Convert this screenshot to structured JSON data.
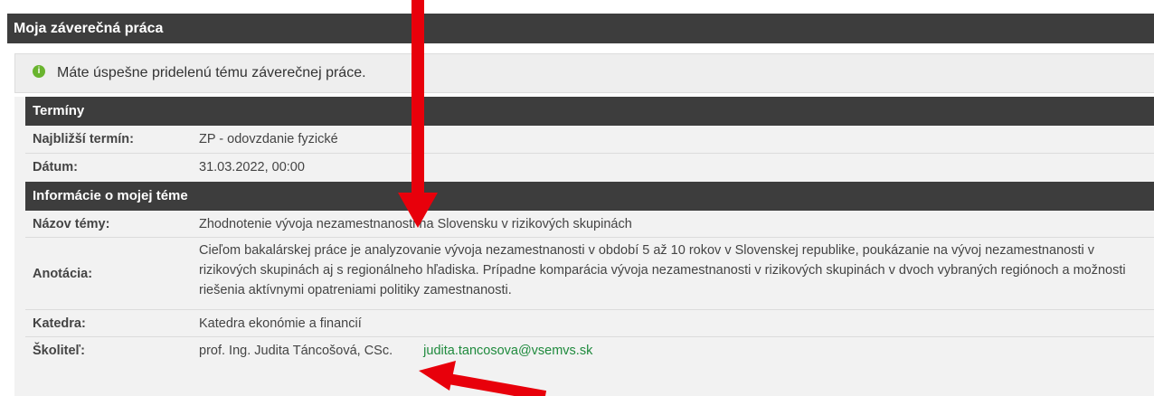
{
  "panel": {
    "title": "Moja záverečná práca"
  },
  "notice": {
    "icon": "info-icon",
    "text": "Máte úspešne pridelenú tému záverečnej práce."
  },
  "terminy": {
    "header": "Termíny",
    "najblizsi_label": "Najbližší termín:",
    "najblizsi_value": "ZP - odovzdanie fyzické",
    "datum_label": "Dátum:",
    "datum_value": "31.03.2022, 00:00"
  },
  "tema": {
    "header": "Informácie o mojej téme",
    "nazov_label": "Názov témy:",
    "nazov_value": "Zhodnotenie vývoja nezamestnanosti na Slovensku v rizikových skupinách",
    "anotacia_label": "Anotácia:",
    "anotacia_value": "Cieľom bakalárskej práce je analyzovanie vývoja nezamestnanosti v období 5 až 10 rokov v Slovenskej republike, poukázanie na vývoj nezamestnanosti v rizikových skupinách aj s regionálneho hľadiska. Prípadne komparácia vývoja nezamestnanosti v rizikových skupinách v dvoch vybraných regiónoch a možnosti riešenia aktívnymi opatreniami politiky zamestnanosti.",
    "katedra_label": "Katedra:",
    "katedra_value": "Katedra ekonómie a financií",
    "skolitel_label": "Školiteľ:",
    "skolitel_value": "prof. Ing. Judita Táncošová, CSc.",
    "skolitel_email": "judita.tancosova@vsemvs.sk"
  },
  "colors": {
    "header_bg": "#3d3d3d",
    "notice_icon": "#69b42e",
    "arrow": "#e8000b",
    "email": "#1f8a3d"
  }
}
